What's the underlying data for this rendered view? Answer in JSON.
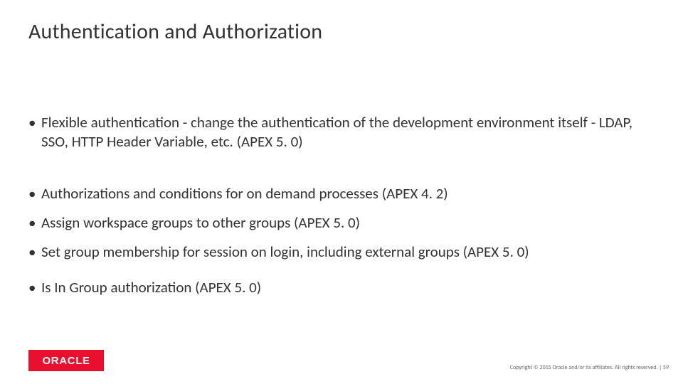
{
  "title": "Authentication and Authorization",
  "bullets": [
    "Flexible authentication - change the authentication of the development environment itself - LDAP, SSO, HTTP Header Variable, etc. (APEX 5. 0)",
    "Authorizations and conditions for on demand processes (APEX 4. 2)",
    "Assign workspace groups to other groups (APEX 5. 0)",
    "Set group membership for session on login, including external groups (APEX 5. 0)",
    "Is In Group authorization (APEX 5. 0)"
  ],
  "logo_text": "ORACLE",
  "copyright": "Copyright © 2015 Oracle and/or its affiliates. All rights reserved.  | 59"
}
